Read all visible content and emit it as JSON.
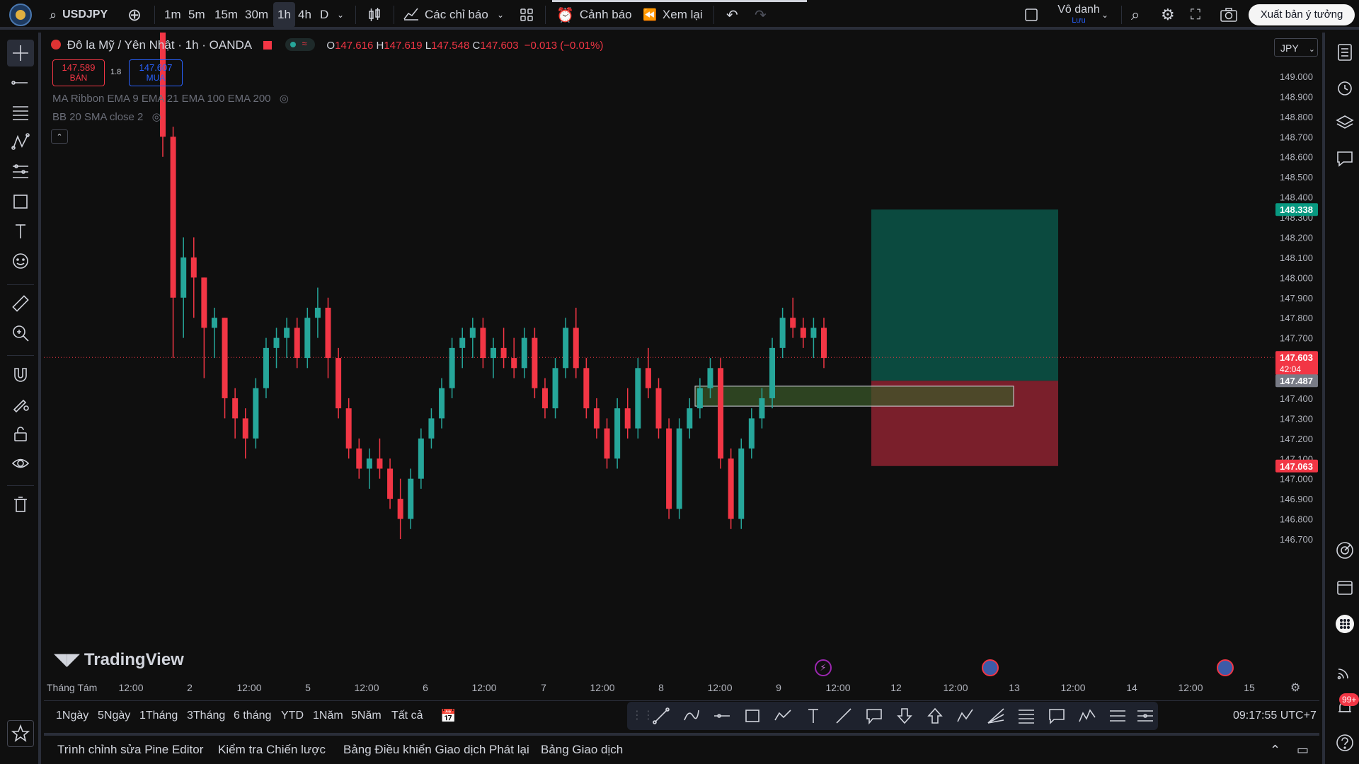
{
  "topbar": {
    "symbol": "USDJPY",
    "timeframes": [
      "1m",
      "5m",
      "15m",
      "30m",
      "1h",
      "4h",
      "D"
    ],
    "active_timeframe": "1h",
    "indicators_label": "Các chỉ báo",
    "alerts_label": "Cảnh báo",
    "replay_label": "Xem lại",
    "layout_name": "Vô danh",
    "layout_sub": "Lưu",
    "publish_label": "Xuất bản ý tưởng"
  },
  "legend": {
    "title": "Đô la Mỹ / Yên Nhật · 1h · OANDA",
    "o_label": "O",
    "o_value": "147.616",
    "h_label": "H",
    "h_value": "147.619",
    "l_label": "L",
    "l_value": "147.548",
    "c_label": "C",
    "c_value": "147.603",
    "change": "−0.013 (−0.01%)",
    "sell_price": "147.589",
    "sell_label": "BÁN",
    "spread": "1.8",
    "buy_price": "147.607",
    "buy_label": "MUA",
    "indicator1": "MA Ribbon EMA 9 EMA 21 EMA 100 EMA 200",
    "indicator2": "BB 20 SMA close 2"
  },
  "price_axis": {
    "currency": "JPY",
    "ticks": [
      "149.000",
      "148.900",
      "148.800",
      "148.700",
      "148.600",
      "148.500",
      "148.400",
      "148.300",
      "148.200",
      "148.100",
      "148.000",
      "147.900",
      "147.800",
      "147.700",
      "147.600",
      "147.500",
      "147.400",
      "147.300",
      "147.200",
      "147.100",
      "147.000",
      "146.900",
      "146.800",
      "146.700"
    ],
    "label_target": "148.338",
    "label_current": "147.603",
    "label_countdown": "42:04",
    "label_entry": "147.487",
    "label_stop": "147.063"
  },
  "time_axis": [
    "Tháng Tám",
    "12:00",
    "2",
    "12:00",
    "5",
    "12:00",
    "6",
    "12:00",
    "7",
    "12:00",
    "8",
    "12:00",
    "9",
    "12:00",
    "12",
    "12:00",
    "13",
    "12:00",
    "14",
    "12:00",
    "15"
  ],
  "watermark": "TradingView",
  "ranges": [
    "1Ngày",
    "5Ngày",
    "1Tháng",
    "3Tháng",
    "6 tháng",
    "YTD",
    "1Năm",
    "5Năm",
    "Tất cả"
  ],
  "clock": "09:17:55 UTC+7",
  "footer_tabs": [
    "Trình chỉnh sửa Pine Editor",
    "Kiểm tra Chiến lược",
    "Bảng Điều khiển Giao dịch Phát lại",
    "Bảng Giao dịch"
  ],
  "notif_badge": "99+",
  "colors": {
    "up": "#26a69a",
    "down": "#f23645",
    "target": "#0b4a3f",
    "stop": "#7a1f2b",
    "zone": "#3a5a2a",
    "current": "#f23645"
  },
  "chart_data": {
    "type": "candlestick",
    "price_range": [
      146.65,
      149.1
    ],
    "candles": [
      [
        149.3,
        149.5,
        148.6,
        148.7
      ],
      [
        148.7,
        148.75,
        147.6,
        147.9
      ],
      [
        147.9,
        148.2,
        147.7,
        148.1
      ],
      [
        148.1,
        148.2,
        147.8,
        148.0
      ],
      [
        148.0,
        148.0,
        147.5,
        147.75
      ],
      [
        147.75,
        147.85,
        147.6,
        147.8
      ],
      [
        147.8,
        147.8,
        147.3,
        147.4
      ],
      [
        147.4,
        147.45,
        147.2,
        147.3
      ],
      [
        147.3,
        147.35,
        147.1,
        147.2
      ],
      [
        147.2,
        147.5,
        147.15,
        147.45
      ],
      [
        147.45,
        147.7,
        147.4,
        147.65
      ],
      [
        147.65,
        147.75,
        147.55,
        147.7
      ],
      [
        147.7,
        147.8,
        147.6,
        147.75
      ],
      [
        147.75,
        147.8,
        147.55,
        147.6
      ],
      [
        147.6,
        147.85,
        147.55,
        147.8
      ],
      [
        147.8,
        147.95,
        147.7,
        147.85
      ],
      [
        147.85,
        147.9,
        147.5,
        147.6
      ],
      [
        147.6,
        147.65,
        147.3,
        147.35
      ],
      [
        147.35,
        147.4,
        147.1,
        147.15
      ],
      [
        147.15,
        147.2,
        147.0,
        147.05
      ],
      [
        147.05,
        147.15,
        146.95,
        147.1
      ],
      [
        147.1,
        147.2,
        147.0,
        147.05
      ],
      [
        147.05,
        147.1,
        146.85,
        146.9
      ],
      [
        146.9,
        147.0,
        146.7,
        146.8
      ],
      [
        146.8,
        147.05,
        146.75,
        147.0
      ],
      [
        147.0,
        147.25,
        146.95,
        147.2
      ],
      [
        147.2,
        147.35,
        147.15,
        147.3
      ],
      [
        147.3,
        147.5,
        147.25,
        147.45
      ],
      [
        147.45,
        147.7,
        147.4,
        147.65
      ],
      [
        147.65,
        147.75,
        147.55,
        147.7
      ],
      [
        147.7,
        147.8,
        147.6,
        147.75
      ],
      [
        147.75,
        147.8,
        147.55,
        147.6
      ],
      [
        147.6,
        147.7,
        147.5,
        147.65
      ],
      [
        147.65,
        147.75,
        147.55,
        147.6
      ],
      [
        147.6,
        147.7,
        147.5,
        147.55
      ],
      [
        147.55,
        147.75,
        147.5,
        147.7
      ],
      [
        147.7,
        147.75,
        147.4,
        147.45
      ],
      [
        147.45,
        147.5,
        147.3,
        147.35
      ],
      [
        147.35,
        147.6,
        147.3,
        147.55
      ],
      [
        147.55,
        147.8,
        147.5,
        147.75
      ],
      [
        147.75,
        147.85,
        147.5,
        147.55
      ],
      [
        147.55,
        147.6,
        147.3,
        147.35
      ],
      [
        147.35,
        147.4,
        147.2,
        147.25
      ],
      [
        147.25,
        147.3,
        147.05,
        147.1
      ],
      [
        147.1,
        147.4,
        147.05,
        147.35
      ],
      [
        147.35,
        147.45,
        147.2,
        147.25
      ],
      [
        147.25,
        147.6,
        147.2,
        147.55
      ],
      [
        147.55,
        147.65,
        147.4,
        147.45
      ],
      [
        147.45,
        147.5,
        147.2,
        147.25
      ],
      [
        147.25,
        147.3,
        146.8,
        146.85
      ],
      [
        146.85,
        147.3,
        146.8,
        147.25
      ],
      [
        147.25,
        147.4,
        147.2,
        147.35
      ],
      [
        147.35,
        147.5,
        147.3,
        147.45
      ],
      [
        147.45,
        147.6,
        147.4,
        147.55
      ],
      [
        147.55,
        147.6,
        147.05,
        147.1
      ],
      [
        147.1,
        147.15,
        146.75,
        146.8
      ],
      [
        146.8,
        147.2,
        146.75,
        147.15
      ],
      [
        147.15,
        147.35,
        147.1,
        147.3
      ],
      [
        147.3,
        147.45,
        147.25,
        147.4
      ],
      [
        147.4,
        147.7,
        147.35,
        147.65
      ],
      [
        147.65,
        147.85,
        147.6,
        147.8
      ],
      [
        147.8,
        147.9,
        147.7,
        147.75
      ],
      [
        147.75,
        147.8,
        147.65,
        147.7
      ],
      [
        147.7,
        147.8,
        147.6,
        147.75
      ],
      [
        147.75,
        147.8,
        147.55,
        147.6
      ]
    ],
    "current_price": 147.603,
    "position": {
      "entry": 147.487,
      "target": 148.338,
      "stop": 147.063
    }
  }
}
